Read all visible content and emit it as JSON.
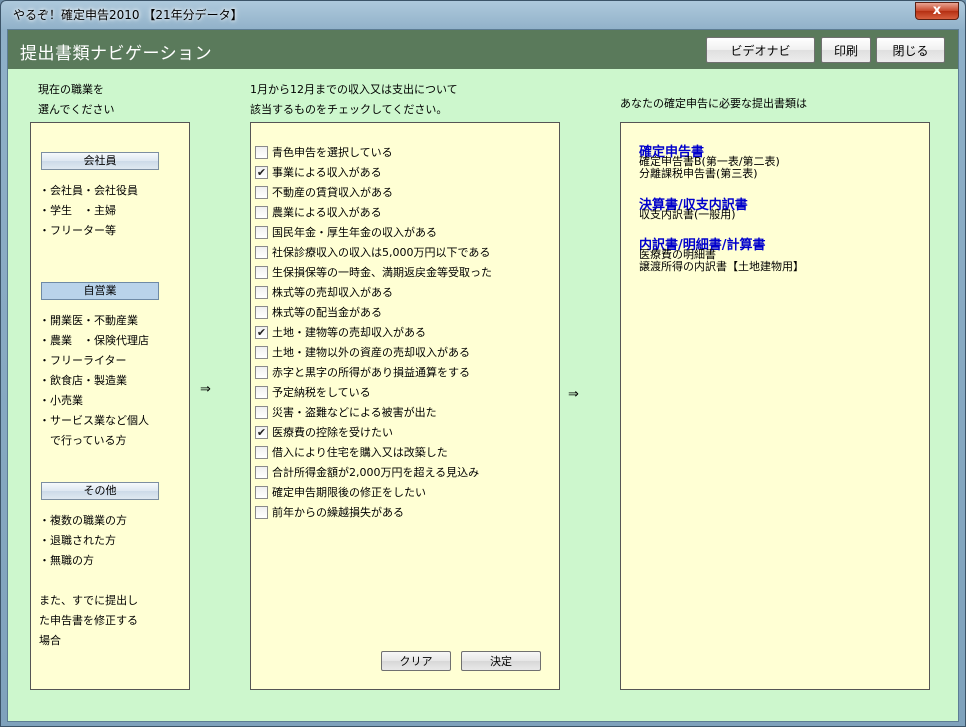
{
  "window": {
    "title": "やるぞ！確定申告2010 【21年分データ】",
    "close_glyph": "x"
  },
  "header": {
    "title": "提出書類ナビゲーション",
    "buttons": [
      "ビデオナビ",
      "印刷",
      "閉じる"
    ]
  },
  "occupation": {
    "instruction": [
      "現在の職業を",
      "選んでください"
    ],
    "categories": [
      {
        "label": "会社員",
        "selected": false,
        "items": [
          "・会社員・会社役員",
          "・学生　・主婦",
          "・フリーター等"
        ]
      },
      {
        "label": "自営業",
        "selected": true,
        "items": [
          "・開業医・不動産業",
          "・農業　・保険代理店",
          "・フリーライター",
          "・飲食店・製造業",
          "・小売業",
          "・サービス業など個人",
          "　で行っている方"
        ]
      },
      {
        "label": "その他",
        "selected": false,
        "items": [
          "・複数の職業の方",
          "・退職された方",
          "・無職の方"
        ]
      }
    ],
    "note": [
      "また、すでに提出し",
      "た申告書を修正する",
      "場合"
    ]
  },
  "arrows": [
    "⇒",
    "⇒"
  ],
  "checklist": {
    "instruction": [
      "1月から12月までの収入又は支出について",
      "該当するものをチェックしてください。"
    ],
    "check_glyph": "✔",
    "items": [
      {
        "label": "青色申告を選択している",
        "checked": false
      },
      {
        "label": "事業による収入がある",
        "checked": true
      },
      {
        "label": "不動産の賃貸収入がある",
        "checked": false
      },
      {
        "label": "農業による収入がある",
        "checked": false
      },
      {
        "label": "国民年金・厚生年金の収入がある",
        "checked": false
      },
      {
        "label": "社保診療収入の収入は5,000万円以下である",
        "checked": false
      },
      {
        "label": "生保損保等の一時金、満期返戻金等受取った",
        "checked": false
      },
      {
        "label": "株式等の売却収入がある",
        "checked": false
      },
      {
        "label": "株式等の配当金がある",
        "checked": false
      },
      {
        "label": "土地・建物等の売却収入がある",
        "checked": true
      },
      {
        "label": "土地・建物以外の資産の売却収入がある",
        "checked": false
      },
      {
        "label": "赤字と黒字の所得があり損益通算をする",
        "checked": false
      },
      {
        "label": "予定納税をしている",
        "checked": false
      },
      {
        "label": "災害・盗難などによる被害が出た",
        "checked": false
      },
      {
        "label": "医療費の控除を受けたい",
        "checked": true
      },
      {
        "label": "借入により住宅を購入又は改築した",
        "checked": false
      },
      {
        "label": "合計所得金額が2,000万円を超える見込み",
        "checked": false
      },
      {
        "label": "確定申告期限後の修正をしたい",
        "checked": false
      },
      {
        "label": "前年からの繰越損失がある",
        "checked": false
      }
    ],
    "clear_label": "クリア",
    "confirm_label": "決定"
  },
  "documents": {
    "instruction": "あなたの確定申告に必要な提出書類は",
    "groups": [
      {
        "heading": "確定申告書",
        "items": [
          "確定申告書B(第一表/第二表)",
          "分離課税申告書(第三表)"
        ]
      },
      {
        "heading": "決算書/収支内訳書",
        "items": [
          "収支内訳書(一般用)"
        ]
      },
      {
        "heading": "内訳書/明細書/計算書",
        "items": [
          "医療費の明細書",
          "譲渡所得の内訳書【土地建物用】"
        ]
      }
    ]
  }
}
